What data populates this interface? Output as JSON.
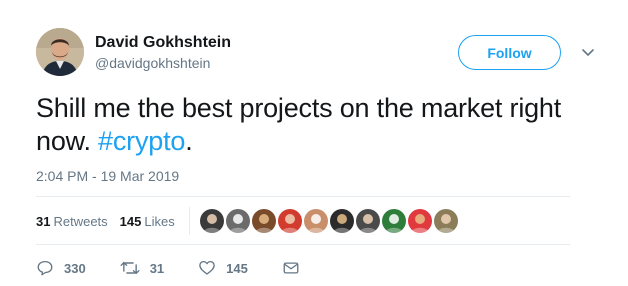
{
  "user": {
    "display_name": "David Gokhshtein",
    "handle": "@davidgokhshtein",
    "avatar_icon": "profile-photo"
  },
  "follow_label": "Follow",
  "tweet": {
    "text": "Shill me the best projects on the market right now. ",
    "hashtag": "#crypto",
    "trailing": ".",
    "timestamp": "2:04 PM - 19 Mar 2019"
  },
  "stats": {
    "retweets_count": "31",
    "retweets_label": "Retweets",
    "likes_count": "145",
    "likes_label": "Likes"
  },
  "likers": [
    {
      "icon": "liker-avatar-1",
      "color": "#3a3a3a"
    },
    {
      "icon": "liker-avatar-2",
      "color": "#6b6b6b"
    },
    {
      "icon": "liker-avatar-3",
      "color": "#7a4b2a"
    },
    {
      "icon": "liker-avatar-4",
      "color": "#d23c2e"
    },
    {
      "icon": "liker-avatar-5",
      "color": "#c98f6a"
    },
    {
      "icon": "liker-avatar-6",
      "color": "#2b2b2b"
    },
    {
      "icon": "liker-avatar-7",
      "color": "#4a4a4a"
    },
    {
      "icon": "liker-avatar-8",
      "color": "#2f7d3a"
    },
    {
      "icon": "liker-avatar-9",
      "color": "#e0393e"
    },
    {
      "icon": "liker-avatar-10",
      "color": "#8b7d5a"
    }
  ],
  "actions": {
    "reply_count": "330",
    "retweet_count": "31",
    "like_count": "145"
  },
  "colors": {
    "accent": "#1da1f2",
    "muted": "#657786",
    "text": "#14171a",
    "divider": "#e6ecf0"
  }
}
